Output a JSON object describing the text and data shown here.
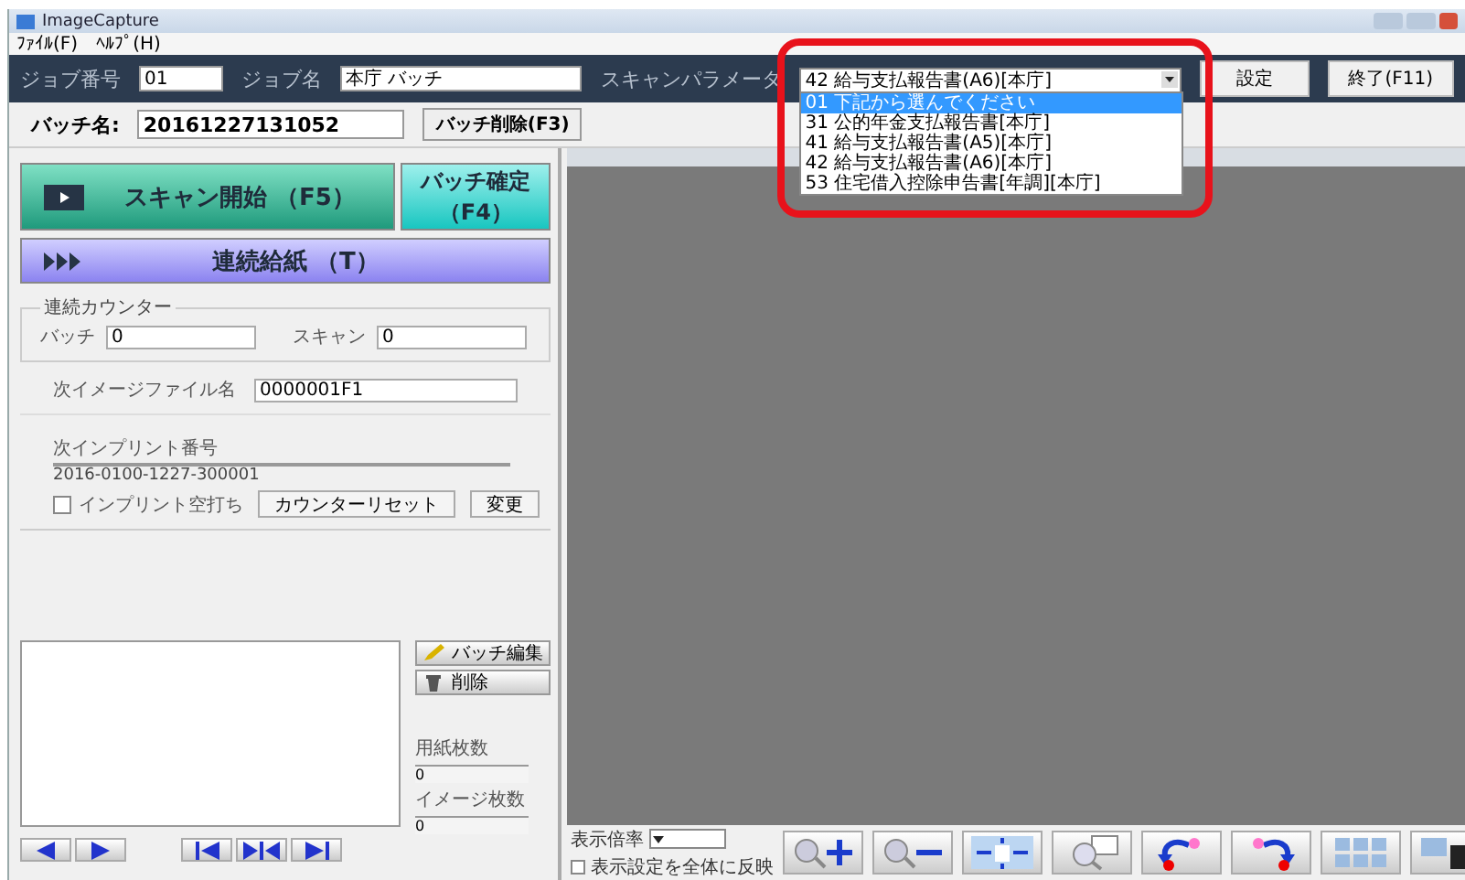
{
  "window": {
    "title": "ImageCapture"
  },
  "menu": [
    "ﾌｧｲﾙ(F)",
    "ﾍﾙﾌﾟ(H)"
  ],
  "toolbar": {
    "job_number_label": "ジョブ番号",
    "job_number": "01",
    "job_name_label": "ジョブ名",
    "job_name": "本庁 バッチ",
    "scan_param_label": "スキャンパラメータ",
    "scan_param": "42 給与支払報告書(A6)[本庁]",
    "settings_button": "設定",
    "exit_button": "終了(F11)"
  },
  "dropdown": {
    "highlighted": true,
    "options": [
      {
        "label": "01 下記から選んでください",
        "selected": true
      },
      {
        "label": "31 公的年金支払報告書[本庁]",
        "selected": false
      },
      {
        "label": "41 給与支払報告書(A5)[本庁]",
        "selected": false
      },
      {
        "label": "42 給与支払報告書(A6)[本庁]",
        "selected": false
      },
      {
        "label": "53 住宅借入控除申告書[年調][本庁]",
        "selected": false
      }
    ]
  },
  "batch": {
    "label": "バッチ名:",
    "value": "20161227131052",
    "delete_button": "バッチ削除(F3)"
  },
  "scan_button": "スキャン開始 （F5）",
  "confirm_button": [
    "バッチ確定",
    "（F4）"
  ],
  "feed_button": "連続給紙 （T）",
  "counter": {
    "title": "連続カウンター",
    "batch_label": "バッチ",
    "batch_value": "0",
    "scan_label": "スキャン",
    "scan_value": "0"
  },
  "next_file": {
    "label": "次イメージファイル名",
    "value": "0000001F1"
  },
  "imprint": {
    "label": "次インプリント番号",
    "value": "2016-0100-1227-300001",
    "blank_label": "インプリント空打ち",
    "blank_checked": false,
    "reset_button": "カウンターリセット",
    "change_button": "変更"
  },
  "side_buttons": [
    "バッチ編集",
    "削除"
  ],
  "paper_count": {
    "label": "用紙枚数",
    "value": "0"
  },
  "image_count": {
    "label": "イメージ枚数",
    "value": "0"
  },
  "nav_buttons": [
    {
      "kind": "prev"
    },
    {
      "kind": "next"
    },
    {
      "kind": "first"
    },
    {
      "kind": "middle"
    },
    {
      "kind": "last"
    }
  ],
  "zoom": {
    "label": "表示倍率",
    "apply_label": "表示設定を全体に反映",
    "apply_checked": false
  },
  "tools": [
    {
      "kind": "zoom-in"
    },
    {
      "kind": "zoom-out"
    },
    {
      "kind": "fit"
    },
    {
      "kind": "zoom-area"
    },
    {
      "kind": "rotate-left"
    },
    {
      "kind": "rotate-right"
    },
    {
      "kind": "grid"
    },
    {
      "kind": "save"
    }
  ]
}
